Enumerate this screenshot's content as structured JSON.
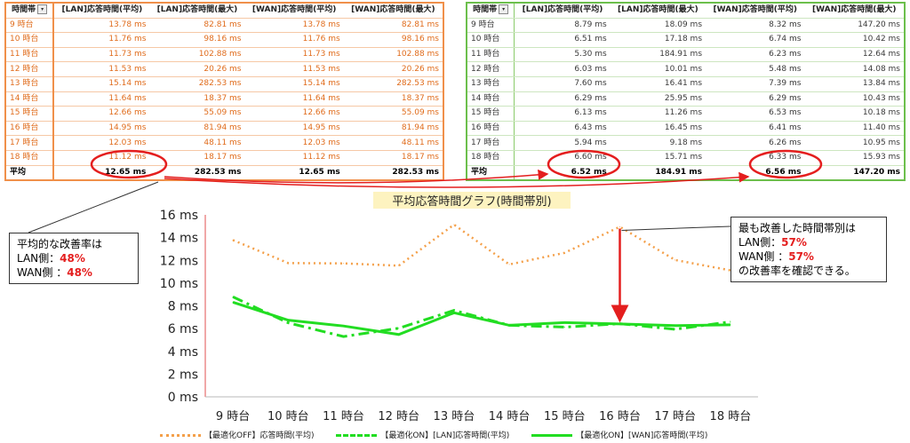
{
  "table_left": {
    "headers": [
      "時間帯",
      "[LAN]応答時間(平均)",
      "[LAN]応答時間(最大)",
      "[WAN]応答時間(平均)",
      "[WAN]応答時間(最大)"
    ],
    "rows": [
      [
        "9 時台",
        "13.78 ms",
        "82.81 ms",
        "13.78 ms",
        "82.81 ms"
      ],
      [
        "10 時台",
        "11.76 ms",
        "98.16 ms",
        "11.76 ms",
        "98.16 ms"
      ],
      [
        "11 時台",
        "11.73 ms",
        "102.88 ms",
        "11.73 ms",
        "102.88 ms"
      ],
      [
        "12 時台",
        "11.53 ms",
        "20.26 ms",
        "11.53 ms",
        "20.26 ms"
      ],
      [
        "13 時台",
        "15.14 ms",
        "282.53 ms",
        "15.14 ms",
        "282.53 ms"
      ],
      [
        "14 時台",
        "11.64 ms",
        "18.37 ms",
        "11.64 ms",
        "18.37 ms"
      ],
      [
        "15 時台",
        "12.66 ms",
        "55.09 ms",
        "12.66 ms",
        "55.09 ms"
      ],
      [
        "16 時台",
        "14.95 ms",
        "81.94 ms",
        "14.95 ms",
        "81.94 ms"
      ],
      [
        "17 時台",
        "12.03 ms",
        "48.11 ms",
        "12.03 ms",
        "48.11 ms"
      ],
      [
        "18 時台",
        "11.12 ms",
        "18.17 ms",
        "11.12 ms",
        "18.17 ms"
      ]
    ],
    "average": [
      "平均",
      "12.65 ms",
      "282.53 ms",
      "12.65 ms",
      "282.53 ms"
    ]
  },
  "table_right": {
    "headers": [
      "時間帯",
      "[LAN]応答時間(平均)",
      "[LAN]応答時間(最大)",
      "[WAN]応答時間(平均)",
      "[WAN]応答時間(最大)"
    ],
    "rows": [
      [
        "9 時台",
        "8.79 ms",
        "18.09 ms",
        "8.32 ms",
        "147.20 ms"
      ],
      [
        "10 時台",
        "6.51 ms",
        "17.18 ms",
        "6.74 ms",
        "10.42 ms"
      ],
      [
        "11 時台",
        "5.30 ms",
        "184.91 ms",
        "6.23 ms",
        "12.64 ms"
      ],
      [
        "12 時台",
        "6.03 ms",
        "10.01 ms",
        "5.48 ms",
        "14.08 ms"
      ],
      [
        "13 時台",
        "7.60 ms",
        "16.41 ms",
        "7.39 ms",
        "13.84 ms"
      ],
      [
        "14 時台",
        "6.29 ms",
        "25.95 ms",
        "6.29 ms",
        "10.43 ms"
      ],
      [
        "15 時台",
        "6.13 ms",
        "11.26 ms",
        "6.53 ms",
        "10.18 ms"
      ],
      [
        "16 時台",
        "6.43 ms",
        "16.45 ms",
        "6.41 ms",
        "11.40 ms"
      ],
      [
        "17 時台",
        "5.94 ms",
        "9.18 ms",
        "6.26 ms",
        "10.95 ms"
      ],
      [
        "18 時台",
        "6.60 ms",
        "15.71 ms",
        "6.33 ms",
        "15.93 ms"
      ]
    ],
    "average": [
      "平均",
      "6.52 ms",
      "184.91 ms",
      "6.56 ms",
      "147.20 ms"
    ]
  },
  "callout_left": {
    "line1": "平均的な改善率は",
    "lan_label": "LAN側：",
    "lan_value": "48%",
    "wan_label": "WAN側 ：",
    "wan_value": "48%"
  },
  "callout_right": {
    "line1": "最も改善した時間帯別は",
    "lan_label": "LAN側：",
    "lan_value": "57%",
    "wan_label": "WAN側 ：",
    "wan_value": "57%",
    "line4": "の改善率を確認できる。"
  },
  "colors": {
    "off_series": "#f4a04a",
    "on_series": "#22dd22",
    "highlight": "#e41e1e",
    "title_bg": "#fdf3c0"
  },
  "chart_data": {
    "type": "line",
    "title": "平均応答時間グラフ(時間帯別)",
    "categories": [
      "9 時台",
      "10 時台",
      "11 時台",
      "12 時台",
      "13 時台",
      "14 時台",
      "15 時台",
      "16 時台",
      "17 時台",
      "18 時台"
    ],
    "y_ticks": [
      "0 ms",
      "2 ms",
      "4 ms",
      "6 ms",
      "8 ms",
      "10 ms",
      "12 ms",
      "14 ms",
      "16 ms"
    ],
    "ylim": [
      0,
      16
    ],
    "grid": false,
    "series": [
      {
        "name": "【最適化OFF】応答時間(平均)",
        "style": "dotted",
        "color": "#f4a04a",
        "values": [
          13.78,
          11.76,
          11.73,
          11.53,
          15.14,
          11.64,
          12.66,
          14.95,
          12.03,
          11.12
        ]
      },
      {
        "name": "【最適化ON】[LAN]応答時間(平均)",
        "style": "dash-dot",
        "color": "#22dd22",
        "values": [
          8.79,
          6.51,
          5.3,
          6.03,
          7.6,
          6.29,
          6.13,
          6.43,
          5.94,
          6.6
        ]
      },
      {
        "name": "【最適化ON】[WAN]応答時間(平均)",
        "style": "solid",
        "color": "#22dd22",
        "values": [
          8.32,
          6.74,
          6.23,
          5.48,
          7.39,
          6.29,
          6.53,
          6.41,
          6.26,
          6.33
        ]
      }
    ],
    "legend_position": "bottom"
  }
}
